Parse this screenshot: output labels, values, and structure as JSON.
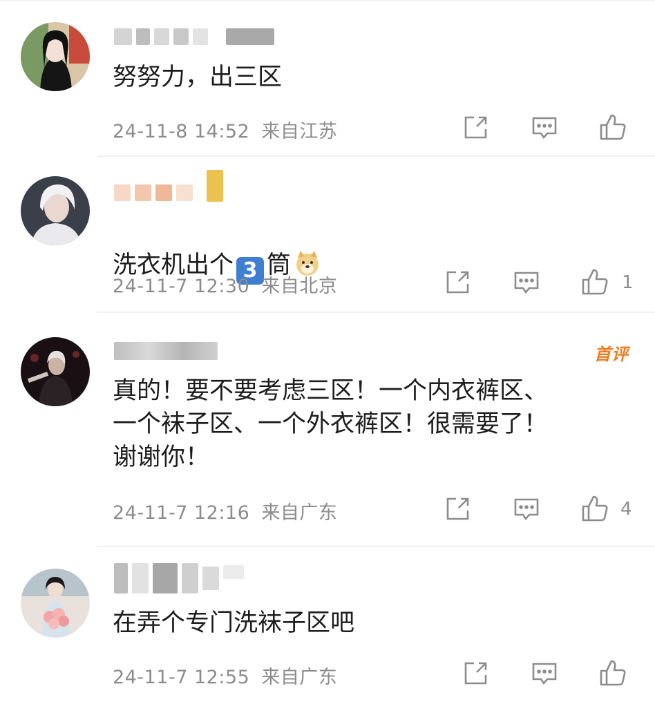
{
  "comments": [
    {
      "text": "努努力，出三区",
      "time": "24-11-8 14:52",
      "location": "来自江苏",
      "likes": ""
    },
    {
      "text_before": "洗衣机出个",
      "emoji_number": "3",
      "text_after": "筒",
      "time": "24-11-7 12:30",
      "location": "来自北京",
      "likes": "1"
    },
    {
      "badge": "首评",
      "text": "真的！要不要考虑三区！一个内衣裤区、\n一个袜子区、一个外衣裤区！很需要了！\n谢谢你！",
      "time": "24-11-7 12:16",
      "location": "来自广东",
      "likes": "4"
    },
    {
      "text": "在弄个专门洗袜子区吧",
      "time": "24-11-7 12:55",
      "location": "来自广东",
      "likes": ""
    }
  ],
  "icons": {
    "share": "share-icon",
    "reply": "comment-icon",
    "like": "thumbs-up-icon"
  },
  "colors": {
    "text": "#1d1d1d",
    "meta": "#8c8c8c",
    "badge": "#f07a1e",
    "separator": "#f1f1f1"
  }
}
